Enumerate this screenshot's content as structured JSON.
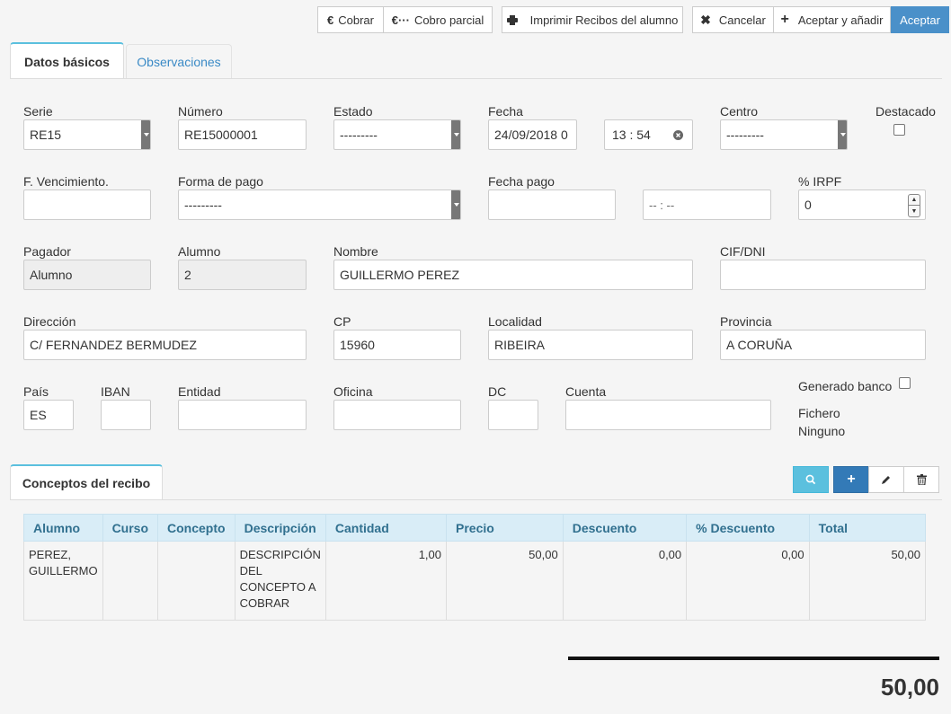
{
  "toolbar": {
    "cobrar": "Cobrar",
    "cobro_parcial": "Cobro parcial",
    "imprimir": "Imprimir Recibos del alumno",
    "cancelar": "Cancelar",
    "aceptar_anadir": "Aceptar y añadir",
    "aceptar": "Aceptar"
  },
  "tabs": {
    "datos": "Datos básicos",
    "observaciones": "Observaciones"
  },
  "form": {
    "serie": {
      "label": "Serie",
      "value": "RE15"
    },
    "numero": {
      "label": "Número",
      "value": "RE15000001"
    },
    "estado": {
      "label": "Estado",
      "value": "---------"
    },
    "fecha": {
      "label": "Fecha",
      "value": "24/09/2018 0",
      "time": "13 : 54"
    },
    "centro": {
      "label": "Centro",
      "value": "---------"
    },
    "destacado": {
      "label": "Destacado"
    },
    "vencimiento": {
      "label": "F. Vencimiento.",
      "value": ""
    },
    "forma_pago": {
      "label": "Forma de pago",
      "value": "---------"
    },
    "fecha_pago": {
      "label": "Fecha pago",
      "value": "",
      "time": "-- : --"
    },
    "irpf": {
      "label": "% IRPF",
      "value": "0"
    },
    "pagador": {
      "label": "Pagador",
      "value": "Alumno"
    },
    "alumno": {
      "label": "Alumno",
      "value": "2"
    },
    "nombre": {
      "label": "Nombre",
      "value": "GUILLERMO PEREZ"
    },
    "cif": {
      "label": "CIF/DNI",
      "value": ""
    },
    "direccion": {
      "label": "Dirección",
      "value": "C/ FERNANDEZ BERMUDEZ"
    },
    "cp": {
      "label": "CP",
      "value": "15960"
    },
    "localidad": {
      "label": "Localidad",
      "value": "RIBEIRA"
    },
    "provincia": {
      "label": "Provincia",
      "value": "A CORUÑA"
    },
    "pais": {
      "label": "País",
      "value": "ES"
    },
    "iban": {
      "label": "IBAN",
      "value": ""
    },
    "entidad": {
      "label": "Entidad",
      "value": ""
    },
    "oficina": {
      "label": "Oficina",
      "value": ""
    },
    "dc": {
      "label": "DC",
      "value": ""
    },
    "cuenta": {
      "label": "Cuenta",
      "value": ""
    },
    "generado_banco": {
      "label": "Generado banco"
    },
    "fichero": {
      "label": "Fichero",
      "value": "Ninguno"
    }
  },
  "conceptos": {
    "tab": "Conceptos del recibo",
    "headers": [
      "Alumno",
      "Curso",
      "Concepto",
      "Descripción",
      "Cantidad",
      "Precio",
      "Descuento",
      "% Descuento",
      "Total"
    ],
    "rows": [
      {
        "alumno": "PEREZ, GUILLERMO",
        "curso": "",
        "concepto": "",
        "descripcion": "DESCRIPCIÓN DEL CONCEPTO A COBRAR",
        "cantidad": "1,00",
        "precio": "50,00",
        "descuento": "0,00",
        "pct_descuento": "0,00",
        "total": "50,00"
      }
    ],
    "total": "50,00"
  }
}
